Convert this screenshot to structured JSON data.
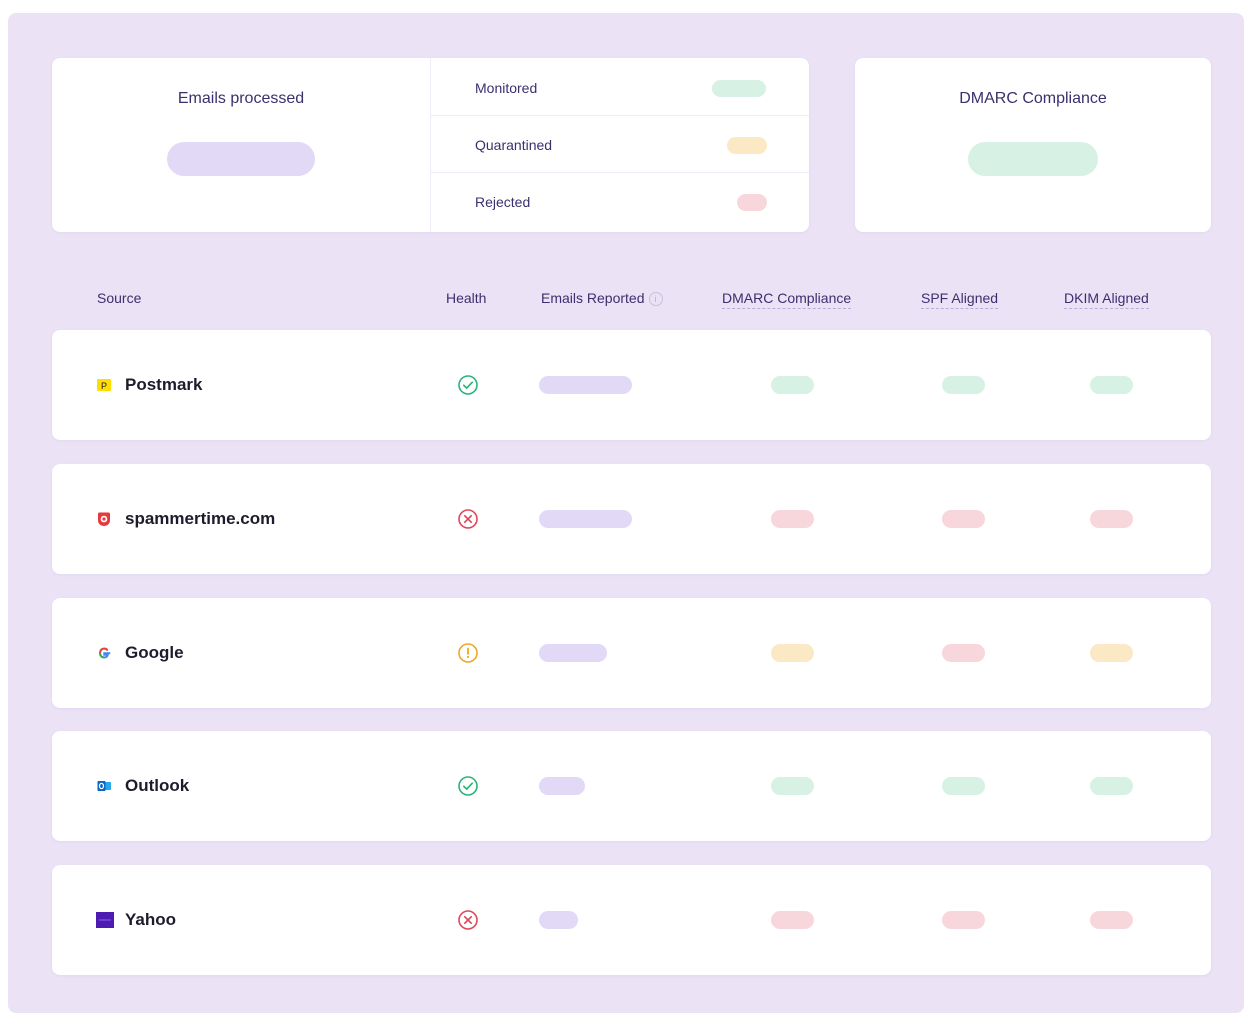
{
  "summary": {
    "emails_processed_label": "Emails processed",
    "legend": [
      {
        "label": "Monitored",
        "color": "#d7f1e5"
      },
      {
        "label": "Quarantined",
        "color": "#fbe8c4"
      },
      {
        "label": "Rejected",
        "color": "#f7d7dc"
      }
    ],
    "dmarc_label": "DMARC Compliance"
  },
  "table": {
    "headers": {
      "source": "Source",
      "health": "Health",
      "emails_reported": "Emails Reported",
      "dmarc": "DMARC Compliance",
      "spf": "SPF Aligned",
      "dkim": "DKIM Aligned"
    },
    "rows": [
      {
        "source": "Postmark",
        "logo": "postmark-logo",
        "health": "ok",
        "emails_reported_level": 1.0,
        "dmarc": "green",
        "spf": "green",
        "dkim": "green"
      },
      {
        "source": "spammertime.com",
        "logo": "spammertime-logo",
        "health": "fail",
        "emails_reported_level": 1.0,
        "dmarc": "red",
        "spf": "red",
        "dkim": "red"
      },
      {
        "source": "Google",
        "logo": "google-logo",
        "health": "warning",
        "emails_reported_level": 0.73,
        "dmarc": "yellow",
        "spf": "red",
        "dkim": "yellow"
      },
      {
        "source": "Outlook",
        "logo": "outlook-logo",
        "health": "ok",
        "emails_reported_level": 0.49,
        "dmarc": "green",
        "spf": "green",
        "dkim": "green"
      },
      {
        "source": "Yahoo",
        "logo": "yahoo-logo",
        "health": "fail",
        "emails_reported_level": 0.42,
        "dmarc": "red",
        "spf": "red",
        "dkim": "red"
      }
    ]
  },
  "colors": {
    "ok": "#2bb47a",
    "fail": "#e0475a",
    "warning": "#f0a722",
    "pill_purple": "#e2d9f6",
    "pill_green": "#d7f1e5",
    "pill_yellow": "#fbe8c4",
    "pill_red": "#f7d7dc",
    "background": "#ebe2f6"
  }
}
